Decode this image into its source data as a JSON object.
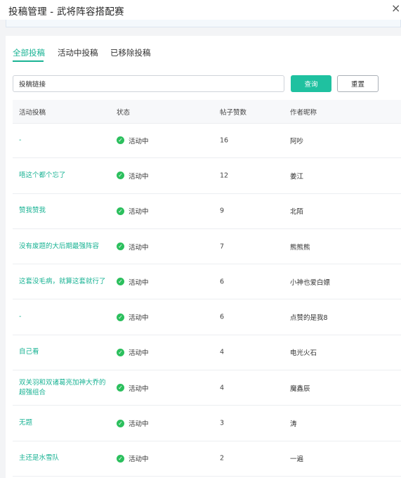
{
  "window": {
    "title": "投稿管理 - 武将阵容搭配赛",
    "close_glyph": "×"
  },
  "tabs": [
    {
      "label": "全部投稿",
      "active": true
    },
    {
      "label": "活动中投稿",
      "active": false
    },
    {
      "label": "已移除投稿",
      "active": false
    }
  ],
  "search": {
    "value": "投稿链接",
    "placeholder": "投稿链接",
    "query_label": "查询",
    "reset_label": "重置"
  },
  "table": {
    "headers": [
      "活动投稿",
      "状态",
      "帖子赞数",
      "作者昵称"
    ],
    "rows": [
      {
        "title": "-",
        "status": "活动中",
        "likes": "16",
        "author": "阿吵"
      },
      {
        "title": "唔这个都个忘了",
        "status": "活动中",
        "likes": "12",
        "author": "姜江"
      },
      {
        "title": "赞我赞我",
        "status": "活动中",
        "likes": "9",
        "author": "北陌"
      },
      {
        "title": "没有废题的大后期最强阵容",
        "status": "活动中",
        "likes": "7",
        "author": "熊熊熊"
      },
      {
        "title": "这套没毛病，就算这套就行了",
        "status": "活动中",
        "likes": "6",
        "author": "小神也爱白嫖"
      },
      {
        "title": "-",
        "status": "活动中",
        "likes": "6",
        "author": "点赞的是我8"
      },
      {
        "title": "自己看",
        "status": "活动中",
        "likes": "4",
        "author": "电光火石"
      },
      {
        "title": "双关羽和双诸葛亮加神大乔的超强组合",
        "status": "活动中",
        "likes": "4",
        "author": "魔鑫辰"
      },
      {
        "title": "无题",
        "status": "活动中",
        "likes": "3",
        "author": "涛"
      },
      {
        "title": "主还是水雪队",
        "status": "活动中",
        "likes": "2",
        "author": "一遍"
      }
    ]
  },
  "colors": {
    "accent": "#1ab394",
    "status_ok": "#2bbf5d"
  },
  "icons": {
    "status": "check-circle-icon",
    "close": "close-icon"
  }
}
